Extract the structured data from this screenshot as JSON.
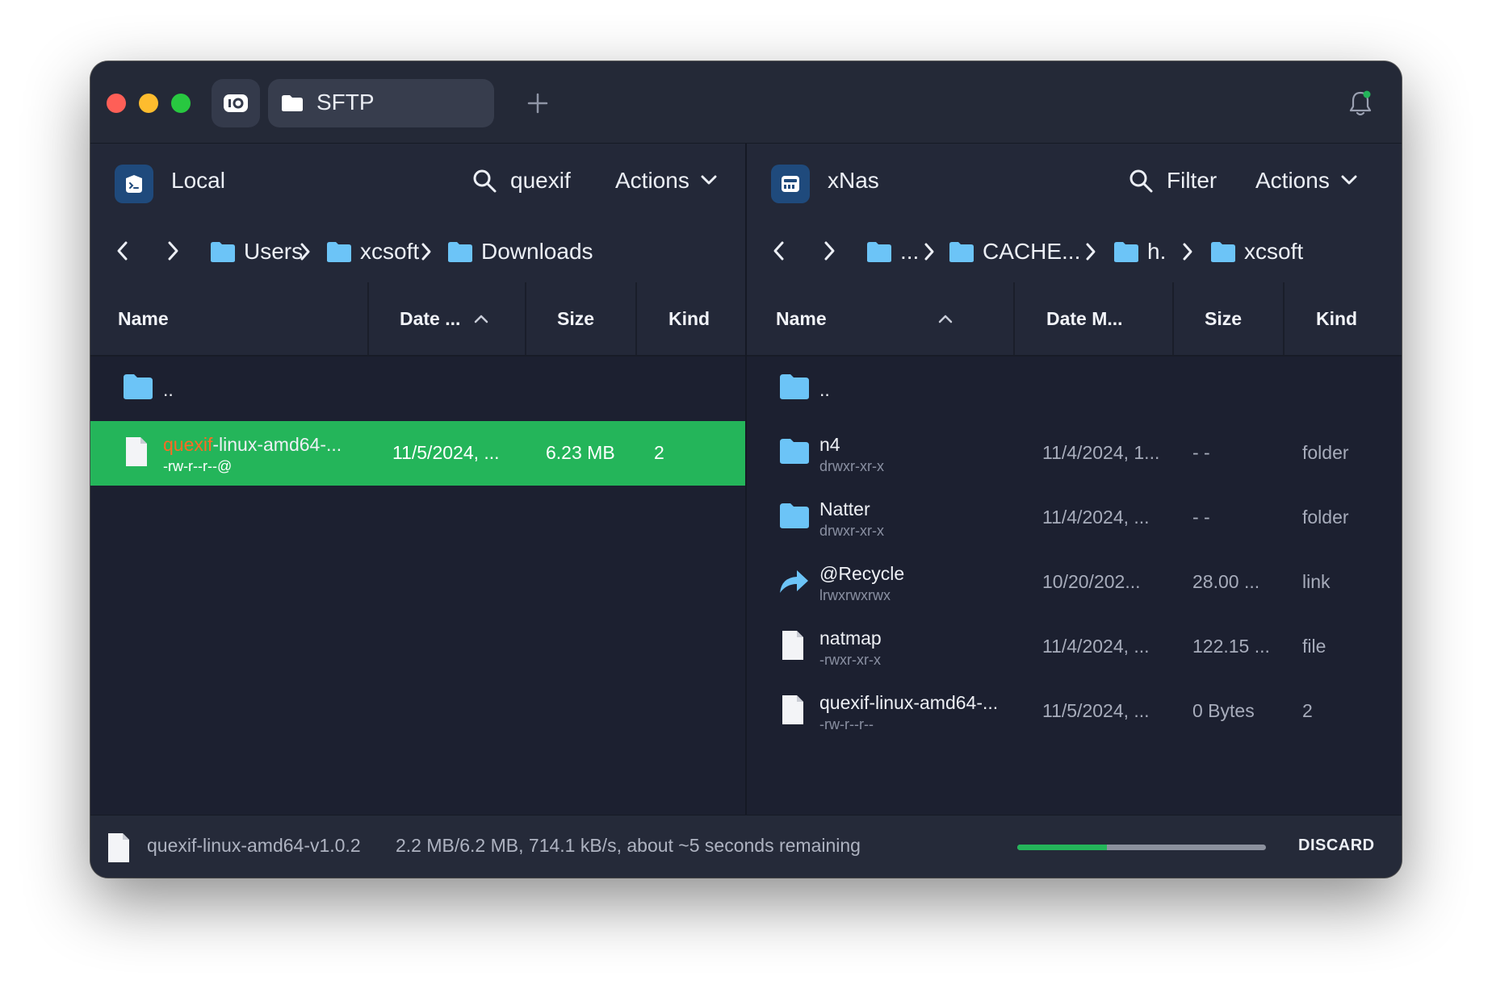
{
  "tab": {
    "label": "SFTP"
  },
  "left": {
    "title": "Local",
    "search_value": "quexif",
    "actions_label": "Actions",
    "breadcrumbs": [
      "Users",
      "xcsoft",
      "Downloads"
    ],
    "columns": {
      "name": "Name",
      "date": "Date ...",
      "size": "Size",
      "kind": "Kind"
    },
    "sort_column": "date",
    "parent_label": "..",
    "rows": [
      {
        "name_highlight": "quexif",
        "name_rest": "-linux-amd64-...",
        "perms": "-rw-r--r--@",
        "date": "11/5/2024, ...",
        "size": "6.23 MB",
        "kind": "2",
        "selected": true,
        "icon": "file-icon"
      }
    ]
  },
  "right": {
    "title": "xNas",
    "search_placeholder": "Filter",
    "actions_label": "Actions",
    "breadcrumbs": [
      "...",
      "CACHE...",
      "h.",
      "xcsoft"
    ],
    "columns": {
      "name": "Name",
      "date": "Date M...",
      "size": "Size",
      "kind": "Kind"
    },
    "sort_column": "name",
    "parent_label": "..",
    "rows": [
      {
        "name": "n4",
        "perms": "drwxr-xr-x",
        "date": "11/4/2024, 1...",
        "size": "- -",
        "kind": "folder",
        "icon": "folder-icon"
      },
      {
        "name": "Natter",
        "perms": "drwxr-xr-x",
        "date": "11/4/2024, ...",
        "size": "- -",
        "kind": "folder",
        "icon": "folder-icon"
      },
      {
        "name": "@Recycle",
        "perms": "lrwxrwxrwx",
        "date": "10/20/202...",
        "size": "28.00 ...",
        "kind": "link",
        "icon": "link-arrow-icon"
      },
      {
        "name": "natmap",
        "perms": "-rwxr-xr-x",
        "date": "11/4/2024, ...",
        "size": "122.15 ...",
        "kind": "file",
        "icon": "file-icon"
      },
      {
        "name": "quexif-linux-amd64-...",
        "perms": "-rw-r--r--",
        "date": "11/5/2024, ...",
        "size": "0 Bytes",
        "kind": "2",
        "icon": "file-icon"
      }
    ]
  },
  "transfer": {
    "file": "quexif-linux-amd64-v1.0.2",
    "info": "2.2 MB/6.2 MB, 714.1 kB/s, about ~5 seconds remaining",
    "progress_fraction": 0.36,
    "discard_label": "DISCARD"
  },
  "colors": {
    "accent_green": "#24b55a",
    "search_highlight": "#ff6a24",
    "folder_blue": "#6cc4f7",
    "window_bg": "#1c2030"
  }
}
